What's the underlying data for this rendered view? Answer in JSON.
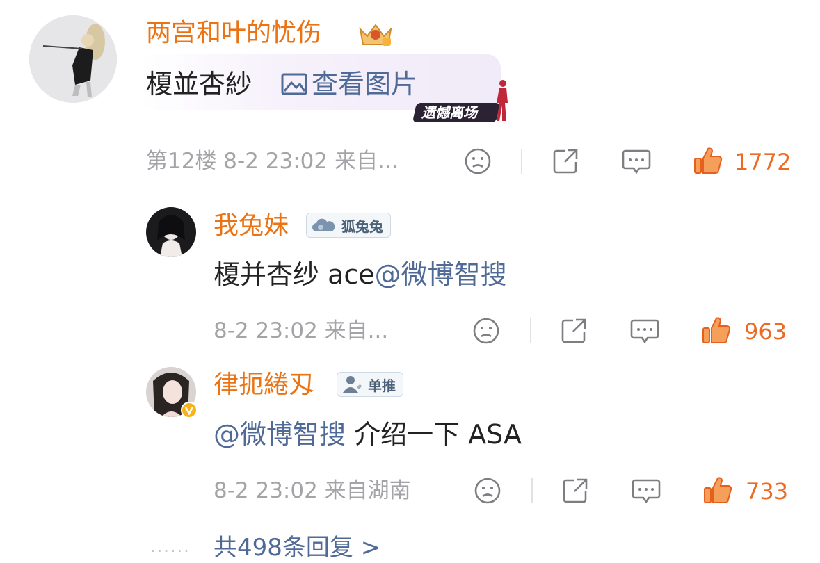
{
  "colors": {
    "username": "#eb7314",
    "link": "#4f6a96",
    "meta": "#a4a4a8",
    "like": "#ec6b23"
  },
  "comment": {
    "username": "两宫和叶的忧伤",
    "badge_icon": "crown-level-icon",
    "text": "榎並杏紗",
    "image_link": "查看图片",
    "decoration_label": "遗憾离场",
    "floor_info": "第12楼 8-2 23:02 来自...",
    "like_count": "1772"
  },
  "replies": [
    {
      "username": "我兔妹",
      "fan_badge": "狐兔兔",
      "text_plain": "榎并杏纱 ace",
      "mention": "@微博智搜",
      "meta": "8-2 23:02 来自...",
      "like_count": "963"
    },
    {
      "username": "律扼綣刄",
      "fan_badge": "单推",
      "verified": true,
      "mention": "@微博智搜",
      "text_plain": " 介绍一下 ASA",
      "meta": "8-2 23:02 来自湖南",
      "like_count": "733"
    }
  ],
  "more_replies": "共498条回复 >",
  "more_dots": "......",
  "action_icons": [
    "dislike-face-icon",
    "share-icon",
    "comment-icon",
    "like-thumb-icon"
  ]
}
